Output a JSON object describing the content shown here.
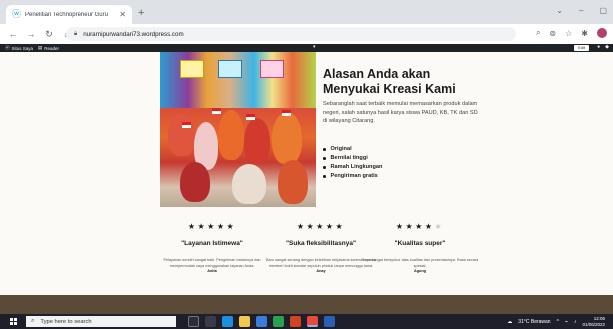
{
  "browser": {
    "tab_title": "Penelitian Technopreneur Guru",
    "url": "nurarnipurwandari73.wordpress.com"
  },
  "wpbar": {
    "my_sites": "Situs Saya",
    "reader": "Reader",
    "edit": "Edit"
  },
  "main": {
    "headline": "Alasan Anda akan Menyukai Kreasi Kami",
    "description": "Sebaranglah saat terbaik memulai memasarkan produk dalam negeri, salah satunya hasil karya siswa PAUD, KB, TK dan SD di wilayang Citarang.",
    "features": [
      "Original",
      "Bernilai tinggi",
      "Ramah Lingkungan",
      "Pengiriman gratis"
    ]
  },
  "testimonials": [
    {
      "rating": 5,
      "title": "\"Layanan Istimewa\"",
      "body": "Pelayanan sendiri sangat baik. Pengiriman bahannya dan mempermudah saya menggunakan layanan Anda.",
      "author": "Anita"
    },
    {
      "rating": 5,
      "title": "\"Suka fleksibilitasnya\"",
      "body": "Baru sangat senang dengan kelebihan kerjasama karena mereka memberi bukti standar sepuluh produk tanpa menunggu lama.",
      "author": "Anay"
    },
    {
      "rating": 4,
      "title": "\"Kualitas super\"",
      "body": "Saya sangat bersyukur atas kualitas dan presentasinya. Rasa secara spesial.",
      "author": "Agung"
    }
  ],
  "taskbar": {
    "search_placeholder": "Type here to search",
    "weather": "31°C  Berawan",
    "time": "12:06",
    "date": "01/06/2022"
  },
  "icons": {
    "tab_favicon": "wordpress-icon",
    "back": "back-arrow-icon",
    "forward": "forward-arrow-icon",
    "reload": "reload-icon",
    "home": "home-icon",
    "lock": "lock-icon",
    "star": "bookmark-star-icon"
  },
  "colors": {
    "headline": "#1b1b1b",
    "footer_band": "#5b4a38",
    "taskbar": "#1f1f2b",
    "wpbar": "#1d2327"
  }
}
